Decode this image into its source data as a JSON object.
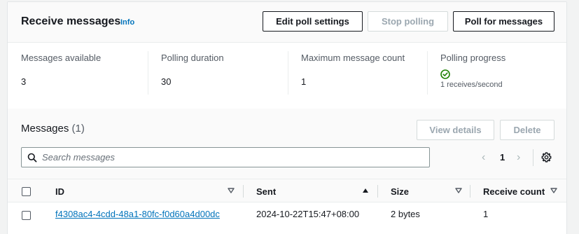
{
  "header": {
    "title": "Receive messages",
    "info_link": "Info",
    "buttons": {
      "edit_poll_settings": "Edit poll settings",
      "stop_polling": "Stop polling",
      "poll_for_messages": "Poll for messages"
    }
  },
  "stats": [
    {
      "label": "Messages available",
      "value": "3"
    },
    {
      "label": "Polling duration",
      "value": "30"
    },
    {
      "label": "Maximum message count",
      "value": "1"
    },
    {
      "label": "Polling progress",
      "rate": "1 receives/second",
      "status_icon": "check-circle-icon"
    }
  ],
  "messages": {
    "title": "Messages",
    "count": "(1)",
    "view_details_label": "View details",
    "delete_label": "Delete",
    "search_placeholder": "Search messages",
    "page": "1"
  },
  "table": {
    "columns": [
      "ID",
      "Sent",
      "Size",
      "Receive count"
    ],
    "rows": [
      {
        "id": "f4308ac4-4cdd-48a1-80fc-f0d60a4d00dc",
        "sent": "2024-10-22T15:47+08:00",
        "size": "2 bytes",
        "receive_count": "1"
      }
    ]
  },
  "colors": {
    "link": "#0073bb",
    "success": "#1d8102",
    "border": "#16191f",
    "disabled": "#9ba7b0"
  }
}
